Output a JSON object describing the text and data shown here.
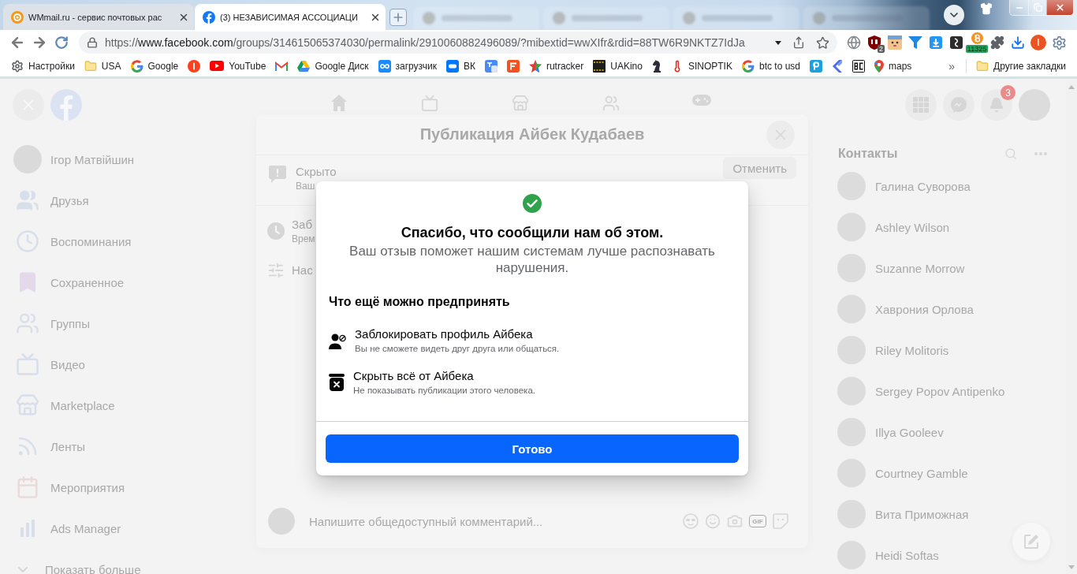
{
  "browser": {
    "tabs": [
      {
        "title": "WMmail.ru - сервис почтовых рас",
        "selected": false
      },
      {
        "title": "(3) НЕЗАВИСИМАЯ АССОЦИАЦИ",
        "selected": true
      }
    ],
    "url": {
      "scheme": "https://",
      "host": "www.facebook.com",
      "path": "/groups/314615065374030/permalink/2910060882496089/?mibextid=wwXIfr&rdid=88TW6R9NKTZ7IdJa"
    },
    "extension_badges": [
      "2",
      "11325"
    ],
    "profile_initial": "I",
    "bookmarks": [
      {
        "kind": "link",
        "label": "Настройки"
      },
      {
        "kind": "folder",
        "label": "USA"
      },
      {
        "kind": "link",
        "label": "Google"
      },
      {
        "kind": "icon"
      },
      {
        "kind": "link",
        "label": "YouTube"
      },
      {
        "kind": "icon"
      },
      {
        "kind": "link",
        "label": "Google Диск"
      },
      {
        "kind": "link",
        "label": "загрузчик"
      },
      {
        "kind": "link",
        "label": "ВК"
      },
      {
        "kind": "icon"
      },
      {
        "kind": "icon"
      },
      {
        "kind": "link",
        "label": "rutracker"
      },
      {
        "kind": "link",
        "label": "UAKino"
      },
      {
        "kind": "icon"
      },
      {
        "kind": "link",
        "label": "SINOPTIK"
      },
      {
        "kind": "link",
        "label": "btc to usd"
      },
      {
        "kind": "icon"
      },
      {
        "kind": "icon"
      },
      {
        "kind": "icon"
      },
      {
        "kind": "link",
        "label": "maps"
      }
    ],
    "bookmarks_overflow": "»",
    "other_bookmarks": "Другие закладки"
  },
  "facebook": {
    "notification_count": "3",
    "menu": [
      {
        "kind": "profile",
        "label": "Ігор Матвійшин"
      },
      {
        "kind": "link",
        "label": "Друзья"
      },
      {
        "kind": "link",
        "label": "Воспоминания"
      },
      {
        "kind": "link",
        "label": "Сохраненное"
      },
      {
        "kind": "link",
        "label": "Группы"
      },
      {
        "kind": "link",
        "label": "Видео"
      },
      {
        "kind": "link",
        "label": "Marketplace"
      },
      {
        "kind": "link",
        "label": "Ленты"
      },
      {
        "kind": "link",
        "label": "Мероприятия"
      },
      {
        "kind": "link",
        "label": "Ads Manager"
      },
      {
        "kind": "more",
        "label": "Показать больше"
      }
    ],
    "post_dialog": {
      "title": "Публикация Айбек Кудабаев",
      "notice": {
        "title": "Скрыто",
        "text": "Ваш",
        "action": "Отменить"
      },
      "options": [
        {
          "kind": "snooze",
          "title": "Заб",
          "text": "Врем"
        },
        {
          "kind": "preferences",
          "title": "Нас"
        }
      ],
      "comment_placeholder": "Напишите общедоступный комментарий...",
      "gif_label": "GIF"
    },
    "contacts": {
      "title": "Контакты",
      "people": [
        "Галина Суворова",
        "Ashley Wilson",
        "Suzanne Morrow",
        "Хаврония Орлова",
        "Riley Molitoris",
        "Sergey Popov Antipenko",
        "Illya Gooleev",
        "Courtney Gamble",
        "Вита Приможная",
        "Heidi Softas"
      ]
    }
  },
  "report_dialog": {
    "title": "Спасибо, что сообщили нам об этом.",
    "message": "Ваш отзыв поможет нашим системам лучше распознавать нарушения.",
    "section_title": "Что ещё можно предпринять",
    "actions": [
      {
        "kind": "block",
        "title": "Заблокировать профиль Айбека",
        "text": "Вы не сможете видеть друг друга или общаться."
      },
      {
        "kind": "hide",
        "title": "Скрыть всё от Айбека",
        "text": "Не показывать публикации этого человека."
      }
    ],
    "button": "Готово"
  }
}
